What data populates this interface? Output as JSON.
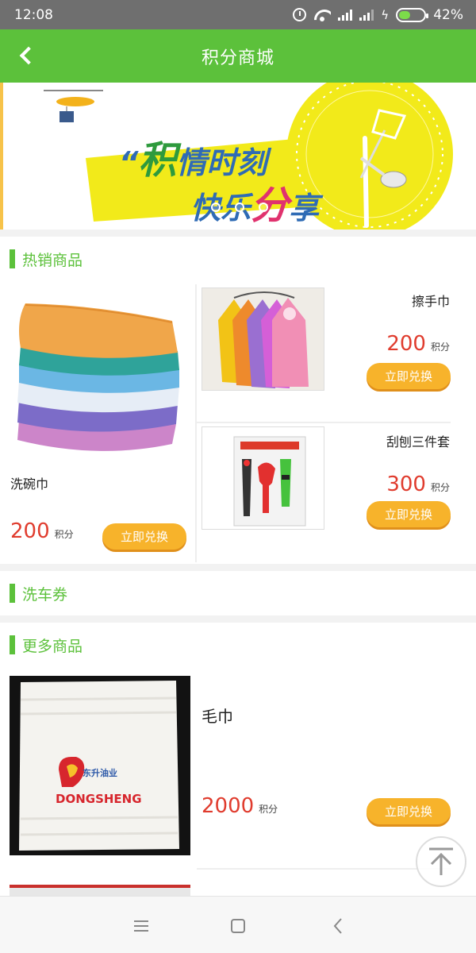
{
  "status": {
    "time": "12:08",
    "battery": "42%"
  },
  "header": {
    "title": "积分商城"
  },
  "banner": {
    "line1_highlight": "积",
    "line1_rest": "情时刻",
    "line2_rest": "快乐",
    "line2_highlight": "分",
    "line2_end": "享",
    "quote": "“"
  },
  "hot": {
    "title": "热销商品",
    "items": [
      {
        "name": "洗碗巾",
        "price": "200",
        "unit": "积分",
        "button": "立即兑换"
      },
      {
        "name": "擦手巾",
        "price": "200",
        "unit": "积分",
        "button": "立即兑换"
      },
      {
        "name": "刮刨三件套",
        "price": "300",
        "unit": "积分",
        "button": "立即兑换"
      }
    ]
  },
  "carwash": {
    "title": "洗车券"
  },
  "more": {
    "title": "更多商品",
    "items": [
      {
        "name": "毛巾",
        "price": "2000",
        "unit": "积分",
        "button": "立即兑换",
        "logo_cn": "东升油业",
        "logo_en": "DONGSHENG"
      }
    ]
  },
  "icons": [
    "alarm-icon",
    "wifi-icon",
    "signal-icon",
    "battery-icon",
    "back-icon",
    "scroll-top-icon",
    "menu-icon",
    "home-icon",
    "nav-back-icon"
  ]
}
